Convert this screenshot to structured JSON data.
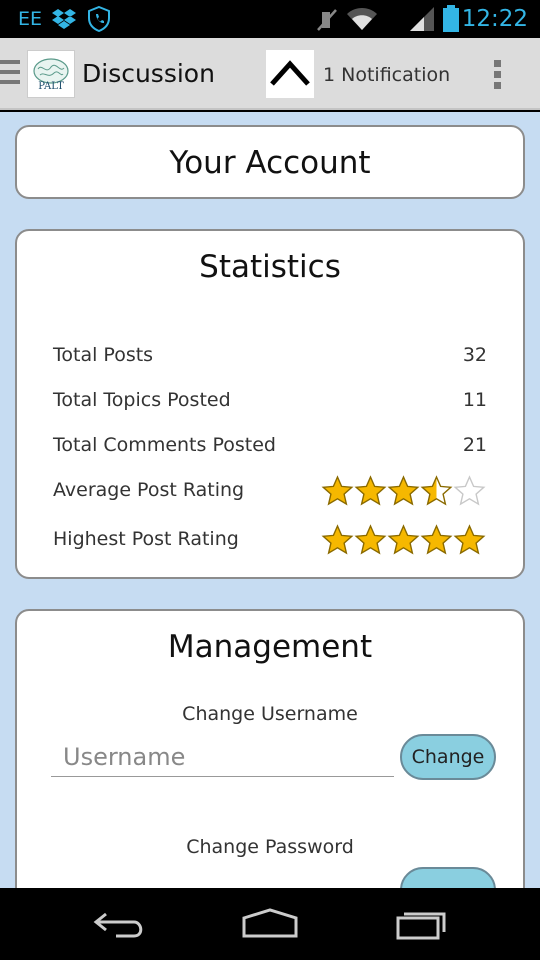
{
  "status_bar": {
    "carrier": "EE",
    "time": "12:22",
    "icons": [
      "dropbox-icon",
      "shield-phone-icon",
      "mute-icon",
      "wifi-icon",
      "signal-icon",
      "battery-icon"
    ]
  },
  "action_bar": {
    "logo_text": "PALT",
    "title": "Discussion",
    "notification": "1 Notification",
    "icons": [
      "menu-icon",
      "chevron-up-icon",
      "overflow-icon"
    ]
  },
  "account": {
    "title": "Your Account"
  },
  "statistics": {
    "title": "Statistics",
    "rows": [
      {
        "label": "Total Posts",
        "value": "32"
      },
      {
        "label": "Total Topics Posted",
        "value": "11"
      },
      {
        "label": "Total Comments Posted",
        "value": "21"
      }
    ],
    "ratings": [
      {
        "label": "Average Post Rating",
        "stars": 3.5,
        "max": 5
      },
      {
        "label": "Highest Post Rating",
        "stars": 5,
        "max": 5
      }
    ]
  },
  "management": {
    "title": "Management",
    "username": {
      "label": "Change Username",
      "placeholder": "Username",
      "button": "Change"
    },
    "password": {
      "label": "Change Password"
    }
  },
  "nav_bar": {
    "icons": [
      "back-icon",
      "home-icon",
      "recents-icon"
    ]
  },
  "colors": {
    "accent": "#33b5e5",
    "background": "#c6dcf2",
    "button": "#8acfe0",
    "star": "#f6b800"
  }
}
